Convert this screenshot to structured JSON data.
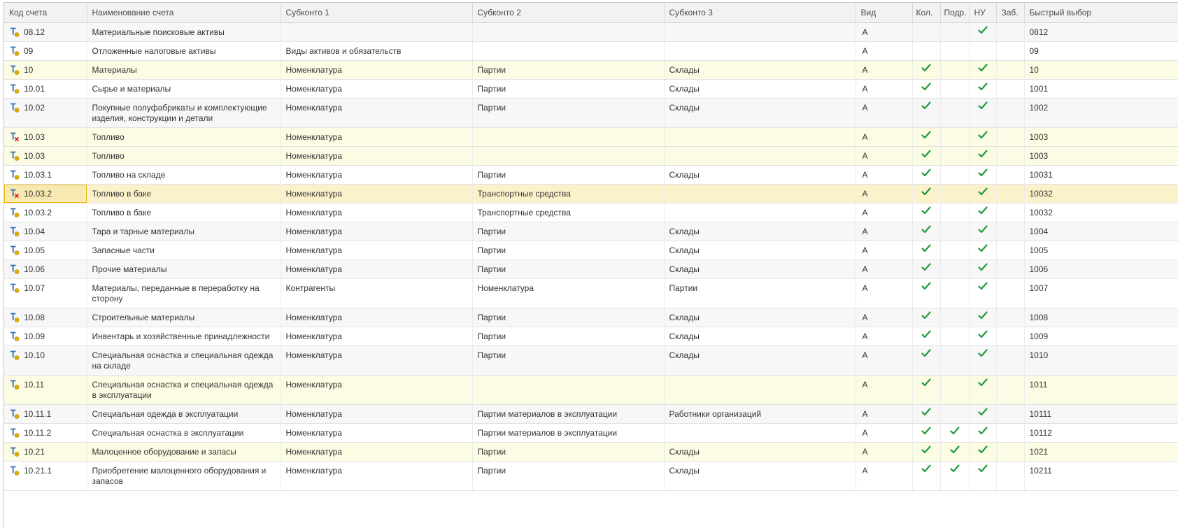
{
  "columns": {
    "code": "Код счета",
    "name": "Наименование счета",
    "sub1": "Субконто 1",
    "sub2": "Субконто 2",
    "sub3": "Субконто 3",
    "kind": "Вид",
    "qty": "Кол.",
    "dept": "Подр.",
    "nu": "НУ",
    "offbal": "Заб.",
    "quick": "Быстрый выбор"
  },
  "rows": [
    {
      "code": "08.12",
      "name": "Материальные поисковые активы",
      "sub1": "",
      "sub2": "",
      "sub3": "",
      "kind": "А",
      "qty": false,
      "dept": false,
      "nu": true,
      "offbal": false,
      "quick": "0812",
      "deleted": false,
      "group": false,
      "two_line": false
    },
    {
      "code": "09",
      "name": "Отложенные налоговые активы",
      "sub1": "Виды активов и обязательств",
      "sub2": "",
      "sub3": "",
      "kind": "А",
      "qty": false,
      "dept": false,
      "nu": false,
      "offbal": false,
      "quick": "09",
      "deleted": false,
      "group": false,
      "two_line": false
    },
    {
      "code": "10",
      "name": "Материалы",
      "sub1": "Номенклатура",
      "sub2": "Партии",
      "sub3": "Склады",
      "kind": "А",
      "qty": true,
      "dept": false,
      "nu": true,
      "offbal": false,
      "quick": "10",
      "deleted": false,
      "group": true,
      "two_line": false
    },
    {
      "code": "10.01",
      "name": "Сырье и материалы",
      "sub1": "Номенклатура",
      "sub2": "Партии",
      "sub3": "Склады",
      "kind": "А",
      "qty": true,
      "dept": false,
      "nu": true,
      "offbal": false,
      "quick": "1001",
      "deleted": false,
      "group": false,
      "two_line": false
    },
    {
      "code": "10.02",
      "name": "Покупные полуфабрикаты и комплектующие изделия, конструкции и детали",
      "sub1": "Номенклатура",
      "sub2": "Партии",
      "sub3": "Склады",
      "kind": "А",
      "qty": true,
      "dept": false,
      "nu": true,
      "offbal": false,
      "quick": "1002",
      "deleted": false,
      "group": false,
      "two_line": true
    },
    {
      "code": "10.03",
      "name": "Топливо",
      "sub1": "Номенклатура",
      "sub2": "",
      "sub3": "",
      "kind": "А",
      "qty": true,
      "dept": false,
      "nu": true,
      "offbal": false,
      "quick": "1003",
      "deleted": true,
      "group": true,
      "two_line": false
    },
    {
      "code": "10.03",
      "name": "Топливо",
      "sub1": "Номенклатура",
      "sub2": "",
      "sub3": "",
      "kind": "А",
      "qty": true,
      "dept": false,
      "nu": true,
      "offbal": false,
      "quick": "1003",
      "deleted": false,
      "group": true,
      "two_line": false
    },
    {
      "code": "10.03.1",
      "name": "Топливо на складе",
      "sub1": "Номенклатура",
      "sub2": "Партии",
      "sub3": "Склады",
      "kind": "А",
      "qty": true,
      "dept": false,
      "nu": true,
      "offbal": false,
      "quick": "10031",
      "deleted": false,
      "group": false,
      "two_line": false
    },
    {
      "code": "10.03.2",
      "name": "Топливо в баке",
      "sub1": "Номенклатура",
      "sub2": "Транспортные средства",
      "sub3": "",
      "kind": "А",
      "qty": true,
      "dept": false,
      "nu": true,
      "offbal": false,
      "quick": "10032",
      "deleted": true,
      "group": false,
      "two_line": false,
      "selected": true
    },
    {
      "code": "10.03.2",
      "name": "Топливо в баке",
      "sub1": "Номенклатура",
      "sub2": "Транспортные средства",
      "sub3": "",
      "kind": "А",
      "qty": true,
      "dept": false,
      "nu": true,
      "offbal": false,
      "quick": "10032",
      "deleted": false,
      "group": false,
      "two_line": false
    },
    {
      "code": "10.04",
      "name": "Тара и тарные материалы",
      "sub1": "Номенклатура",
      "sub2": "Партии",
      "sub3": "Склады",
      "kind": "А",
      "qty": true,
      "dept": false,
      "nu": true,
      "offbal": false,
      "quick": "1004",
      "deleted": false,
      "group": false,
      "two_line": false
    },
    {
      "code": "10.05",
      "name": "Запасные части",
      "sub1": "Номенклатура",
      "sub2": "Партии",
      "sub3": "Склады",
      "kind": "А",
      "qty": true,
      "dept": false,
      "nu": true,
      "offbal": false,
      "quick": "1005",
      "deleted": false,
      "group": false,
      "two_line": false
    },
    {
      "code": "10.06",
      "name": "Прочие материалы",
      "sub1": "Номенклатура",
      "sub2": "Партии",
      "sub3": "Склады",
      "kind": "А",
      "qty": true,
      "dept": false,
      "nu": true,
      "offbal": false,
      "quick": "1006",
      "deleted": false,
      "group": false,
      "two_line": false
    },
    {
      "code": "10.07",
      "name": "Материалы, переданные в переработку на сторону",
      "sub1": "Контрагенты",
      "sub2": "Номенклатура",
      "sub3": "Партии",
      "kind": "А",
      "qty": true,
      "dept": false,
      "nu": true,
      "offbal": false,
      "quick": "1007",
      "deleted": false,
      "group": false,
      "two_line": true
    },
    {
      "code": "10.08",
      "name": "Строительные материалы",
      "sub1": "Номенклатура",
      "sub2": "Партии",
      "sub3": "Склады",
      "kind": "А",
      "qty": true,
      "dept": false,
      "nu": true,
      "offbal": false,
      "quick": "1008",
      "deleted": false,
      "group": false,
      "two_line": false
    },
    {
      "code": "10.09",
      "name": "Инвентарь и хозяйственные принадлежности",
      "sub1": "Номенклатура",
      "sub2": "Партии",
      "sub3": "Склады",
      "kind": "А",
      "qty": true,
      "dept": false,
      "nu": true,
      "offbal": false,
      "quick": "1009",
      "deleted": false,
      "group": false,
      "two_line": false
    },
    {
      "code": "10.10",
      "name": "Специальная оснастка и специальная одежда на складе",
      "sub1": "Номенклатура",
      "sub2": "Партии",
      "sub3": "Склады",
      "kind": "А",
      "qty": true,
      "dept": false,
      "nu": true,
      "offbal": false,
      "quick": "1010",
      "deleted": false,
      "group": false,
      "two_line": true
    },
    {
      "code": "10.11",
      "name": "Специальная оснастка и специальная одежда в эксплуатации",
      "sub1": "Номенклатура",
      "sub2": "",
      "sub3": "",
      "kind": "А",
      "qty": true,
      "dept": false,
      "nu": true,
      "offbal": false,
      "quick": "1011",
      "deleted": false,
      "group": true,
      "two_line": true
    },
    {
      "code": "10.11.1",
      "name": "Специальная одежда в эксплуатации",
      "sub1": "Номенклатура",
      "sub2": "Партии материалов в эксплуатации",
      "sub3": "Работники организаций",
      "kind": "А",
      "qty": true,
      "dept": false,
      "nu": true,
      "offbal": false,
      "quick": "10111",
      "deleted": false,
      "group": false,
      "two_line": false
    },
    {
      "code": "10.11.2",
      "name": "Специальная оснастка в эксплуатации",
      "sub1": "Номенклатура",
      "sub2": "Партии материалов в эксплуатации",
      "sub3": "",
      "kind": "А",
      "qty": true,
      "dept": true,
      "nu": true,
      "offbal": false,
      "quick": "10112",
      "deleted": false,
      "group": false,
      "two_line": false
    },
    {
      "code": "10.21",
      "name": "Малоценное оборудование и запасы",
      "sub1": "Номенклатура",
      "sub2": "Партии",
      "sub3": "Склады",
      "kind": "А",
      "qty": true,
      "dept": true,
      "nu": true,
      "offbal": false,
      "quick": "1021",
      "deleted": false,
      "group": true,
      "two_line": false
    },
    {
      "code": "10.21.1",
      "name": "Приобретение малоценного оборудования и запасов",
      "sub1": "Номенклатура",
      "sub2": "Партии",
      "sub3": "Склады",
      "kind": "А",
      "qty": true,
      "dept": true,
      "nu": true,
      "offbal": false,
      "quick": "10211",
      "deleted": false,
      "group": false,
      "two_line": true
    }
  ],
  "colors": {
    "check": "#1f9a3c",
    "icon_blue": "#2e6fb5",
    "icon_dot": "#e0b000",
    "delete_mark": "#d42020",
    "group_row": "#fcfbe3",
    "selected_row": "#fbf2cc",
    "selected_border": "#f0b400"
  },
  "icons": {
    "account": "account-icon",
    "account_deleted": "account-deleted-icon",
    "check": "check-icon"
  }
}
